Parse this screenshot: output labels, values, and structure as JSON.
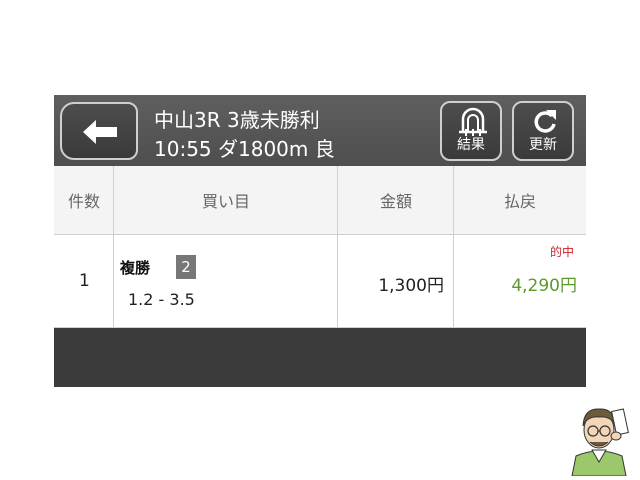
{
  "header": {
    "title_line1": "中山3R 3歳未勝利",
    "title_line2": "10:55 ダ1800m 良",
    "result_label": "結果",
    "refresh_label": "更新"
  },
  "table": {
    "columns": [
      "件数",
      "買い目",
      "金額",
      "払戻"
    ],
    "rows": [
      {
        "count": "1",
        "bet_type": "複勝",
        "horse_number": "2",
        "odds": "1.2 - 3.5",
        "amount": "1,300円",
        "hit_label": "的中",
        "payout": "4,290円"
      }
    ]
  },
  "colors": {
    "header_bg": "#555555",
    "footer_bg": "#3b3b3b",
    "hit": "#d0232a",
    "payout": "#5b9a2a"
  },
  "icons": [
    "back-arrow-icon",
    "result-icon",
    "refresh-icon",
    "mascot-illustration"
  ]
}
